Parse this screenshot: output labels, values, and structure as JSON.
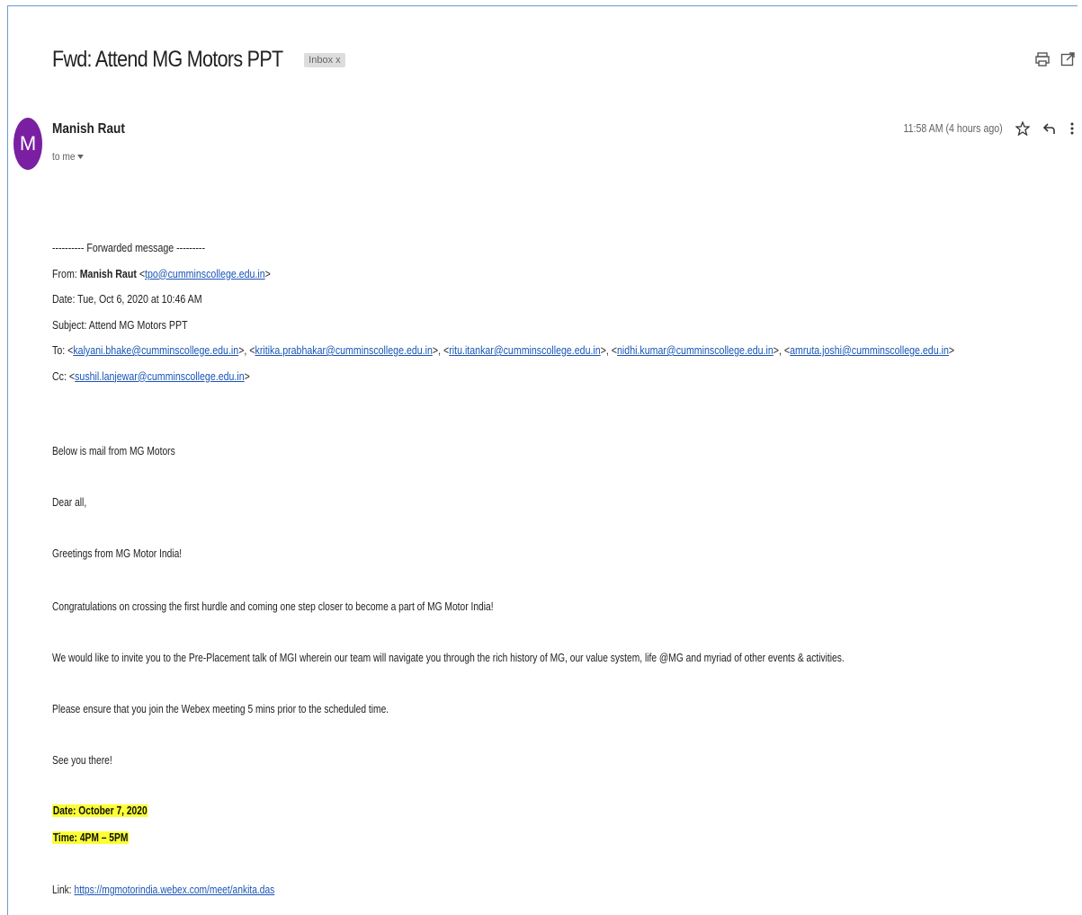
{
  "header": {
    "subject": "Fwd: Attend MG Motors PPT",
    "label": "Inbox",
    "label_close": "x",
    "icons": [
      "print-icon",
      "open-in-new-window-icon"
    ]
  },
  "message": {
    "avatar_letter": "M",
    "avatar_color": "#7b1fa2",
    "sender": "Manish Raut",
    "to": "to me",
    "time": "11:58 AM (4 hours ago)"
  },
  "forwarded": {
    "divider": "---------- Forwarded message ---------",
    "from_label": "From:",
    "from_name": "Manish Raut",
    "from_email": "tpo@cumminscollege.edu.in",
    "date": "Date: Tue, Oct 6, 2020 at 10:46 AM",
    "subject": "Subject: Attend MG Motors PPT",
    "to_label": "To:",
    "to": [
      "kalyani.bhake@cumminscollege.edu.in",
      "kritika.prabhakar@cumminscollege.edu.in",
      "ritu.itankar@cumminscollege.edu.in",
      "nidhi.kumar@cumminscollege.edu.in",
      "amruta.joshi@cumminscollege.edu.in"
    ],
    "cc_label": "Cc:",
    "cc": "sushil.lanjewar@cumminscollege.edu.in"
  },
  "body": {
    "intro": "Below is mail from MG Motors",
    "greeting": "Dear all,",
    "greetings_line": "Greetings from MG Motor India!",
    "congrats": "Congratulations on crossing the first hurdle and coming one step closer to become a part of MG Motor India!",
    "invite": "We would like to invite you to the Pre-Placement talk of MGI wherein our team will navigate you through the rich history of MG, our value system, life @MG and myriad of other events & activities.",
    "ensure": "Please ensure that you join the Webex meeting 5 mins prior to the scheduled time.",
    "see_you": "See you there!",
    "date_line": "Date: October 7, 2020",
    "time_line": "Time: 4PM – 5PM",
    "link_label": "Link:",
    "link": "https://mgmotorindia.webex.com/meet/ankita.das",
    "highlight_color": "#fbff34"
  }
}
